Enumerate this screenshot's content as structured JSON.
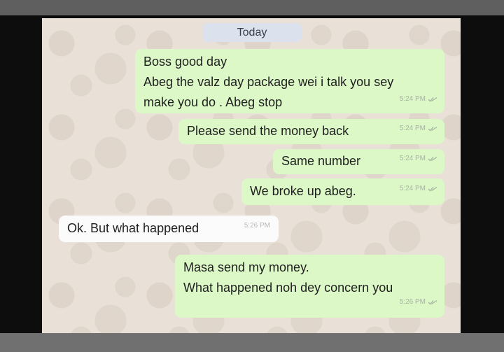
{
  "chat": {
    "date_label": "Today",
    "messages": [
      {
        "direction": "outgoing",
        "lines": [
          "Boss good day",
          "Abeg the valz day package wei i talk you sey",
          "make you do . Abeg stop"
        ],
        "time": "5:24 PM",
        "status_icon": "double-check-icon"
      },
      {
        "direction": "outgoing",
        "lines": [
          "Please send the money back"
        ],
        "time": "5:24 PM",
        "status_icon": "double-check-icon"
      },
      {
        "direction": "outgoing",
        "lines": [
          "Same number"
        ],
        "time": "5:24 PM",
        "status_icon": "double-check-icon"
      },
      {
        "direction": "outgoing",
        "lines": [
          "We broke up abeg."
        ],
        "time": "5:24 PM",
        "status_icon": "double-check-icon"
      },
      {
        "direction": "incoming",
        "lines": [
          "Ok. But what happened"
        ],
        "time": "5:26 PM"
      },
      {
        "direction": "outgoing",
        "lines": [
          "Masa send my money.",
          "What happened noh dey concern you"
        ],
        "time": "5:26 PM",
        "status_icon": "double-check-icon"
      }
    ]
  },
  "colors": {
    "outgoing_bubble": "#dcf8c7",
    "incoming_bubble": "#fbfbfb",
    "chat_background": "#e9e1d7",
    "date_pill": "#dbe2ee"
  }
}
